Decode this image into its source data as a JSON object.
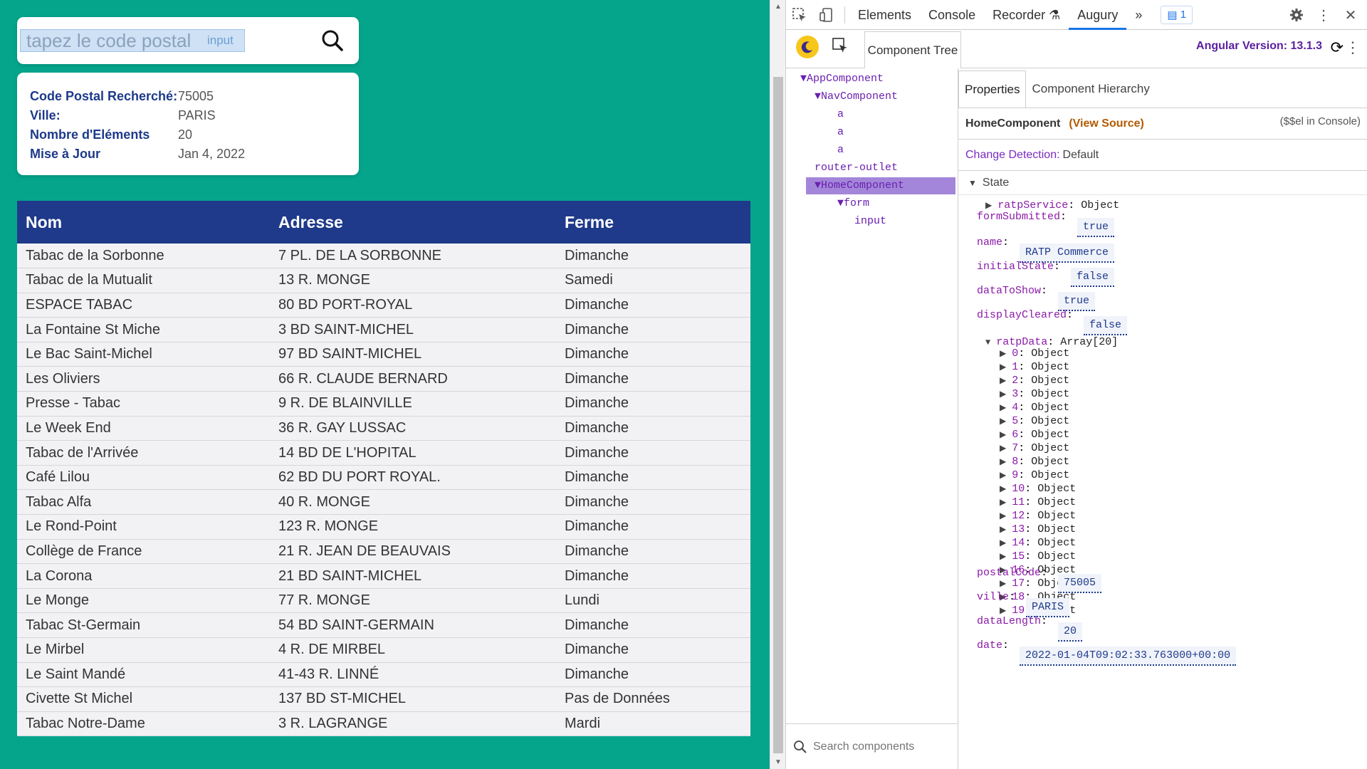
{
  "search": {
    "placeholder": "tapez le code postal",
    "input_tag": "input"
  },
  "info": {
    "rows": [
      {
        "label": "Code Postal Recherché:",
        "value": "75005"
      },
      {
        "label": "Ville:",
        "value": "PARIS"
      },
      {
        "label": "Nombre d'Eléments",
        "value": "20"
      },
      {
        "label": "Mise à Jour",
        "value": "Jan 4, 2022"
      }
    ]
  },
  "table": {
    "headers": [
      "Nom",
      "Adresse",
      "Ferme"
    ],
    "rows": [
      [
        "Tabac de la Sorbonne",
        "7 PL. DE LA SORBONNE",
        "Dimanche"
      ],
      [
        "Tabac de la Mutualit",
        "13 R. MONGE",
        "Samedi"
      ],
      [
        "ESPACE TABAC",
        "80 BD PORT-ROYAL",
        "Dimanche"
      ],
      [
        "La Fontaine St Miche",
        "3 BD SAINT-MICHEL",
        "Dimanche"
      ],
      [
        "Le Bac Saint-Michel",
        "97 BD SAINT-MICHEL",
        "Dimanche"
      ],
      [
        "Les Oliviers",
        "66 R. CLAUDE BERNARD",
        "Dimanche"
      ],
      [
        "Presse - Tabac",
        "9 R. DE BLAINVILLE",
        "Dimanche"
      ],
      [
        "Le Week End",
        "36 R. GAY LUSSAC",
        "Dimanche"
      ],
      [
        "Tabac de l'Arrivée",
        "14 BD DE L'HOPITAL",
        "Dimanche"
      ],
      [
        "Café Lilou",
        "62 BD DU PORT ROYAL.",
        "Dimanche"
      ],
      [
        "Tabac Alfa",
        "40 R. MONGE",
        "Dimanche"
      ],
      [
        "Le Rond-Point",
        "123 R. MONGE",
        "Dimanche"
      ],
      [
        "Collège de France",
        "21 R. JEAN DE BEAUVAIS",
        "Dimanche"
      ],
      [
        "La Corona",
        "21 BD SAINT-MICHEL",
        "Dimanche"
      ],
      [
        "Le Monge",
        "77 R. MONGE",
        "Lundi"
      ],
      [
        "Tabac St-Germain",
        "54 BD SAINT-GERMAIN",
        "Dimanche"
      ],
      [
        "Le Mirbel",
        "4 R. DE MIRBEL",
        "Dimanche"
      ],
      [
        "Le Saint Mandé",
        "41-43 R. LINNÉ",
        "Dimanche"
      ],
      [
        "Civette St Michel",
        "137 BD ST-MICHEL",
        "Pas de Données"
      ],
      [
        "Tabac Notre-Dame",
        "3 R. LAGRANGE",
        "Mardi"
      ]
    ]
  },
  "devtools": {
    "tabs": [
      "Elements",
      "Console",
      "Recorder",
      "Augury"
    ],
    "active_tab": "Augury",
    "more": "»",
    "message_count": "1",
    "augury": {
      "component_tree_tab": "Component Tree",
      "angular_version": "Angular Version: 13.1.3",
      "tree": [
        {
          "label": "▼AppComponent",
          "level": 0
        },
        {
          "label": "▼NavComponent",
          "level": 1
        },
        {
          "label": "a",
          "level": 2
        },
        {
          "label": "a",
          "level": 2
        },
        {
          "label": "a",
          "level": 2
        },
        {
          "label": "router-outlet",
          "level": 1
        },
        {
          "label": "▼HomeComponent",
          "level": 1,
          "selected": true
        },
        {
          "label": "▼form",
          "level": 2
        },
        {
          "label": "input",
          "level": 3
        }
      ],
      "search_placeholder": "Search components",
      "props_tabs": [
        "Properties",
        "Component Hierarchy"
      ],
      "component_name": "HomeComponent",
      "view_source": "(View Source)",
      "console_hint": "($$el in Console)",
      "change_detection_label": "Change Detection:",
      "change_detection_value": "Default",
      "state_label": "State",
      "state": {
        "ratpService": "Object",
        "formSubmitted": "true",
        "name": "RATP Commerce",
        "initialState": "false",
        "dataToShow": "true",
        "displayCleared": "false",
        "ratpData_label": "Array[20]",
        "ratpData_items": [
          "0",
          "1",
          "2",
          "3",
          "4",
          "5",
          "6",
          "7",
          "8",
          "9",
          "10",
          "11",
          "12",
          "13",
          "14",
          "15",
          "16",
          "17",
          "18",
          "19"
        ],
        "item_type": "Object",
        "postalCode": "75005",
        "ville": "PARIS",
        "dataLength": "20",
        "date": "2022-01-04T09:02:33.763000+00:00"
      }
    }
  },
  "colors": {
    "app_bg": "#05a58c",
    "table_header": "#1f3a8a",
    "augury_purple": "#6a1fb0"
  }
}
